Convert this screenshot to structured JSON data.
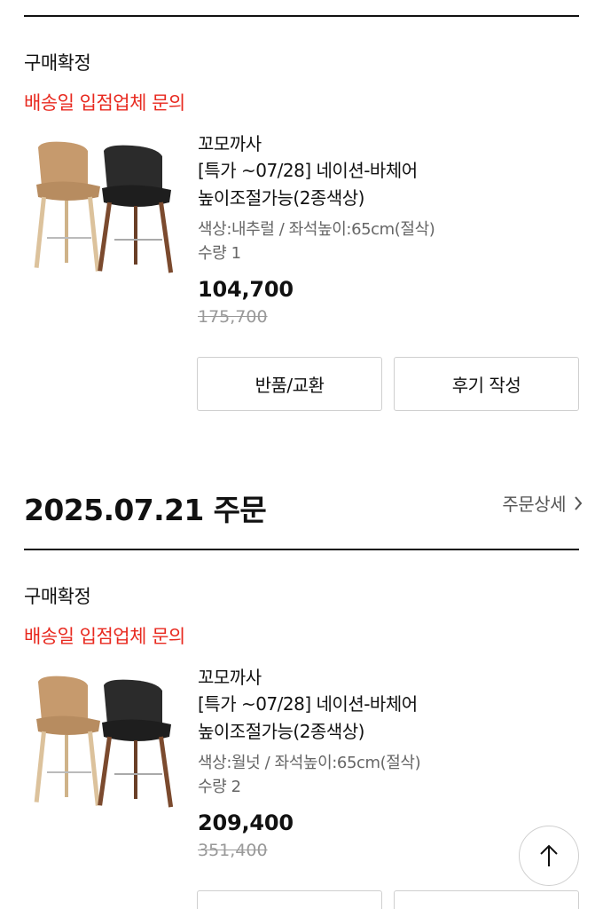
{
  "orders": [
    {
      "status": "구매확정",
      "delivery_notice": "배송일 입점업체 문의",
      "brand": "꼬모까사",
      "title_line1": "[특가 ~07/28] 네이션-바체어",
      "title_line2": "높이조절가능(2종색상)",
      "option": "색상:내추럴 / 좌석높이:65cm(절삭)",
      "quantity": "수량 1",
      "price": "104,700",
      "original_price": "175,700",
      "return_button": "반품/교환",
      "review_button": "후기 작성"
    },
    {
      "status": "구매확정",
      "delivery_notice": "배송일 입점업체 문의",
      "brand": "꼬모까사",
      "title_line1": "[특가 ~07/28] 네이션-바체어",
      "title_line2": "높이조절가능(2종색상)",
      "option": "색상:월넛 / 좌석높이:65cm(절삭)",
      "quantity": "수량 2",
      "price": "209,400",
      "original_price": "351,400"
    }
  ],
  "order_header": {
    "date": "2025.07.21 주문",
    "detail_link": "주문상세"
  },
  "icons": {
    "detail_arrow": "chevron-right-icon",
    "scroll_top": "arrow-up-icon"
  },
  "colors": {
    "delivery_notice": "#e8291f",
    "price": "#111111",
    "original_price": "#999999"
  }
}
